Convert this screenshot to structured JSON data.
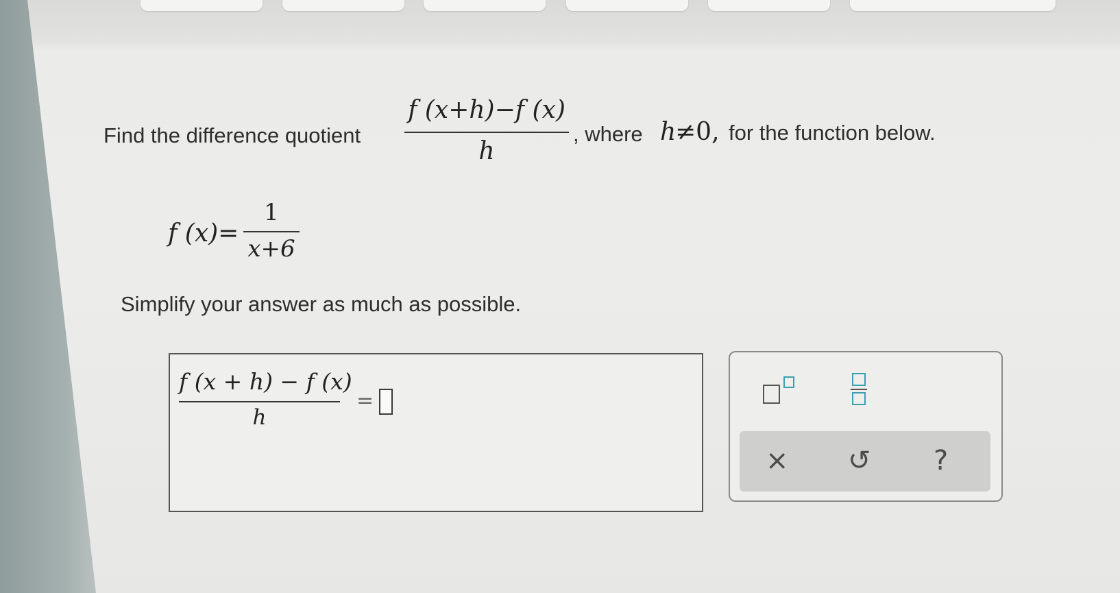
{
  "question": {
    "intro": "Find the difference quotient",
    "quotient_numerator": "f (x+h)−f (x)",
    "quotient_denominator": "h",
    "where_text": ", where",
    "h_var": "h",
    "neq_zero": "≠0,",
    "trailing": "for the function below.",
    "function_lhs": "f (x)=",
    "function_numerator": "1",
    "function_denominator": "x+6",
    "instruction": "Simplify your answer as much as possible."
  },
  "answer": {
    "numerator": "f (x + h) − f (x)",
    "denominator": "h",
    "equals": "=",
    "value": ""
  },
  "toolbar": {
    "superscript_icon": "superscript-template-icon",
    "fraction_icon": "fraction-template-icon",
    "clear_label": "×",
    "undo_label": "↺",
    "help_label": "?"
  },
  "colors": {
    "template_accent": "#3aa0b0",
    "action_bar": "#cfcfcd"
  }
}
